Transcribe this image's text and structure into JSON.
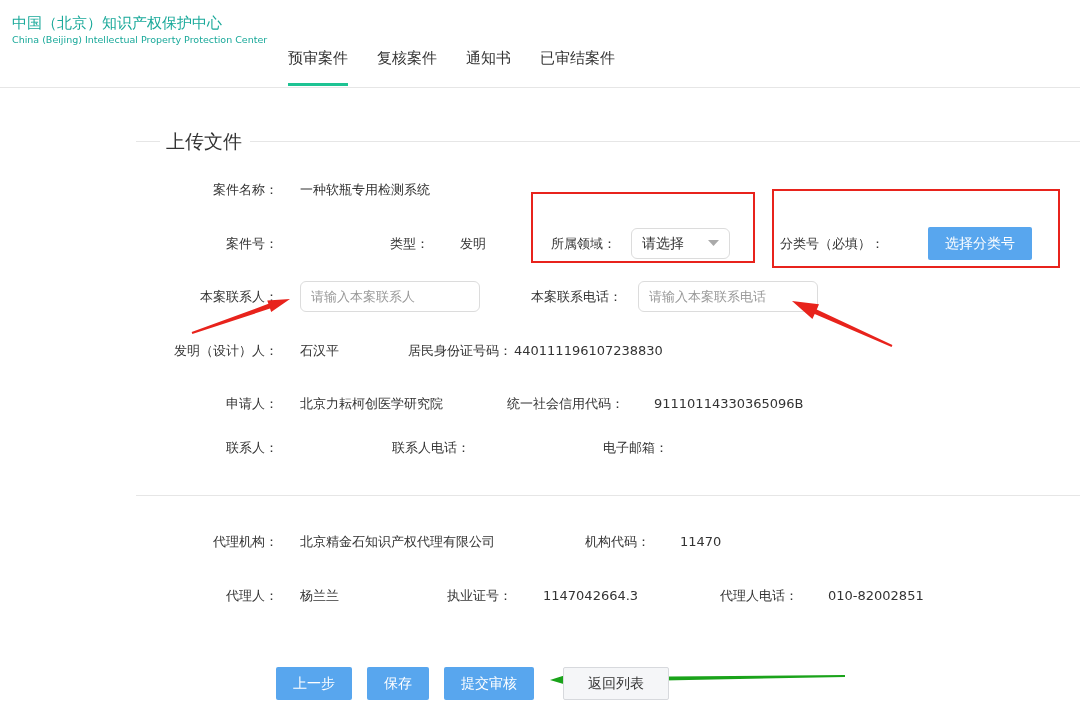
{
  "logo": {
    "title": "中国（北京）知识产权保护中心",
    "subtitle": "China (Beijing) Intellectual Property Protection Center"
  },
  "tabs": [
    {
      "label": "预审案件",
      "selected": true
    },
    {
      "label": "复核案件",
      "selected": false
    },
    {
      "label": "通知书",
      "selected": false
    },
    {
      "label": "已审结案件",
      "selected": false
    }
  ],
  "section_title": "上传文件",
  "applicant_rows": [
    [
      {
        "label": "案件名称：",
        "kind": "text",
        "value": "一种软瓶专用检测系统"
      }
    ],
    [
      {
        "label": "案件号：",
        "kind": "text"
      },
      {
        "label": "类型：",
        "kind": "text",
        "value": "发明"
      },
      {
        "label": "所属领域：",
        "kind": "select",
        "value": "请选择"
      },
      {
        "label": "分类号（必填）：",
        "kind": "button",
        "value": "选择分类号"
      }
    ],
    [
      {
        "label": "本案联系人：",
        "kind": "input",
        "placeholder": "请输入本案联系人"
      },
      {
        "label": "本案联系电话：",
        "kind": "input",
        "placeholder": "请输入本案联系电话"
      }
    ],
    [
      {
        "label": "发明（设计）人：",
        "kind": "text",
        "value": "石汉平"
      },
      {
        "label": "居民身份证号码：",
        "kind": "text",
        "value": "440111196107238830"
      }
    ],
    [
      {
        "label": "申请人：",
        "kind": "text",
        "value": "北京力耘柯创医学研究院"
      },
      {
        "label": "统一社会信用代码：",
        "kind": "text",
        "value": "91110114330365096B"
      }
    ],
    [
      {
        "label": "联系人：",
        "kind": "text"
      },
      {
        "label": "联系人电话：",
        "kind": "text"
      },
      {
        "label": "电子邮箱：",
        "kind": "text"
      }
    ]
  ],
  "agency_rows": [
    [
      {
        "label": "代理机构：",
        "kind": "text",
        "value": "北京精金石知识产权代理有限公司"
      },
      {
        "label": "机构代码：",
        "kind": "text",
        "value": "11470"
      }
    ],
    [
      {
        "label": "代理人：",
        "kind": "text",
        "value": "杨兰兰"
      },
      {
        "label": "执业证号：",
        "kind": "text",
        "value": "1147042664.3"
      },
      {
        "label": "代理人电话：",
        "kind": "text",
        "value": "010-82002851"
      }
    ]
  ],
  "actions": [
    {
      "label": "上一步",
      "kind": "primary"
    },
    {
      "label": "保存",
      "kind": "primary"
    },
    {
      "label": "提交审核",
      "kind": "primary"
    },
    {
      "label": "返回列表",
      "kind": "outline"
    }
  ],
  "annotations": [
    {
      "kind": "box",
      "color": "#e8231c"
    },
    {
      "kind": "box",
      "color": "#e8231c"
    },
    {
      "kind": "arrow",
      "color": "#e8231c"
    },
    {
      "kind": "arrow",
      "color": "#e8231c"
    },
    {
      "kind": "arrow",
      "color": "#1aa31a"
    }
  ]
}
